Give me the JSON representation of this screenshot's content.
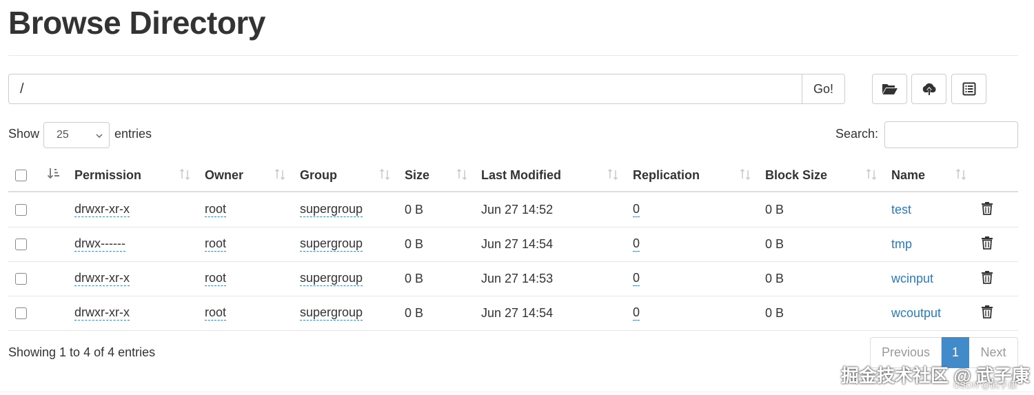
{
  "page": {
    "title": "Browse Directory"
  },
  "pathbar": {
    "value": "/",
    "go_label": "Go!"
  },
  "toolbar": {
    "buttons": [
      {
        "icon": "folder-open-icon"
      },
      {
        "icon": "cloud-upload-icon"
      },
      {
        "icon": "list-icon"
      }
    ]
  },
  "length": {
    "show_label": "Show",
    "selected": "25",
    "entries_label": "entries"
  },
  "search": {
    "label": "Search:",
    "value": ""
  },
  "table": {
    "columns": [
      "Permission",
      "Owner",
      "Group",
      "Size",
      "Last Modified",
      "Replication",
      "Block Size",
      "Name"
    ],
    "rows": [
      {
        "permission": "drwxr-xr-x",
        "owner": "root",
        "group": "supergroup",
        "size": "0 B",
        "modified": "Jun 27 14:52",
        "replication": "0",
        "block_size": "0 B",
        "name": "test"
      },
      {
        "permission": "drwx------",
        "owner": "root",
        "group": "supergroup",
        "size": "0 B",
        "modified": "Jun 27 14:54",
        "replication": "0",
        "block_size": "0 B",
        "name": "tmp"
      },
      {
        "permission": "drwxr-xr-x",
        "owner": "root",
        "group": "supergroup",
        "size": "0 B",
        "modified": "Jun 27 14:53",
        "replication": "0",
        "block_size": "0 B",
        "name": "wcinput"
      },
      {
        "permission": "drwxr-xr-x",
        "owner": "root",
        "group": "supergroup",
        "size": "0 B",
        "modified": "Jun 27 14:54",
        "replication": "0",
        "block_size": "0 B",
        "name": "wcoutput"
      }
    ]
  },
  "info": {
    "text": "Showing 1 to 4 of 4 entries"
  },
  "pagination": {
    "previous": "Previous",
    "current": "1",
    "next": "Next"
  },
  "watermark": {
    "main": "掘金技术社区 @ 武子康",
    "small": "CSDN @武子康"
  },
  "colors": {
    "link": "#2a7bbd",
    "active_page": "#428bca"
  }
}
